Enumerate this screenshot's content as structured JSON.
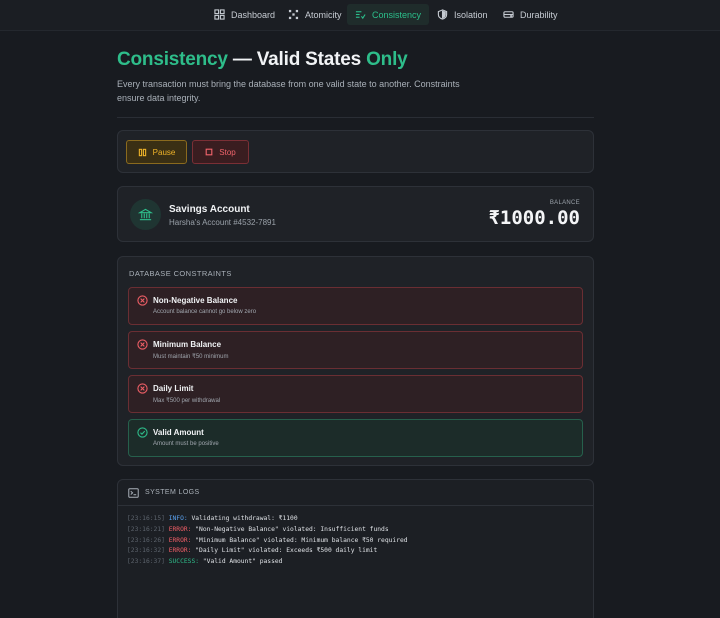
{
  "nav": {
    "items": [
      {
        "label": "Dashboard",
        "icon": "grid-icon",
        "active": false
      },
      {
        "label": "Atomicity",
        "icon": "atom-icon",
        "active": false
      },
      {
        "label": "Consistency",
        "icon": "sliders-check-icon",
        "active": true
      },
      {
        "label": "Isolation",
        "icon": "shield-icon",
        "active": false
      },
      {
        "label": "Durability",
        "icon": "hard-drive-icon",
        "active": false
      }
    ]
  },
  "header": {
    "title_part1": "Consistency",
    "title_part2": " — Valid States ",
    "title_part3": "Only",
    "subtitle": "Every transaction must bring the database from one valid state to another. Constraints ensure data integrity."
  },
  "controls": {
    "pause_label": "Pause",
    "stop_label": "Stop"
  },
  "account": {
    "name": "Savings Account",
    "number": "Harsha's Account #4532-7891",
    "balance_label": "BALANCE",
    "balance": "₹1000.00"
  },
  "constraints": {
    "title": "DATABASE CONSTRAINTS",
    "items": [
      {
        "name": "Non-Negative Balance",
        "desc": "Account balance cannot go below zero",
        "status": "fail"
      },
      {
        "name": "Minimum Balance",
        "desc": "Must maintain ₹50 minimum",
        "status": "fail"
      },
      {
        "name": "Daily Limit",
        "desc": "Max ₹500 per withdrawal",
        "status": "fail"
      },
      {
        "name": "Valid Amount",
        "desc": "Amount must be positive",
        "status": "pass"
      }
    ]
  },
  "logs": {
    "title": "SYSTEM LOGS",
    "lines": [
      {
        "time": "[23:16:15]",
        "level": "INFO:",
        "msg": "Validating withdrawal: ₹1100"
      },
      {
        "time": "[23:16:21]",
        "level": "ERROR:",
        "msg": "\"Non-Negative Balance\" violated: Insufficient funds"
      },
      {
        "time": "[23:16:26]",
        "level": "ERROR:",
        "msg": "\"Minimum Balance\" violated: Minimum balance ₹50 required"
      },
      {
        "time": "[23:16:32]",
        "level": "ERROR:",
        "msg": "\"Daily Limit\" violated: Exceeds ₹500 daily limit"
      },
      {
        "time": "[23:16:37]",
        "level": "SUCCESS:",
        "msg": "\"Valid Amount\" passed"
      }
    ]
  },
  "colors": {
    "accent": "#2ebd8a",
    "error": "#ef5e66",
    "warning": "#f0b429",
    "info": "#5aa2f0",
    "background": "#181b20"
  }
}
